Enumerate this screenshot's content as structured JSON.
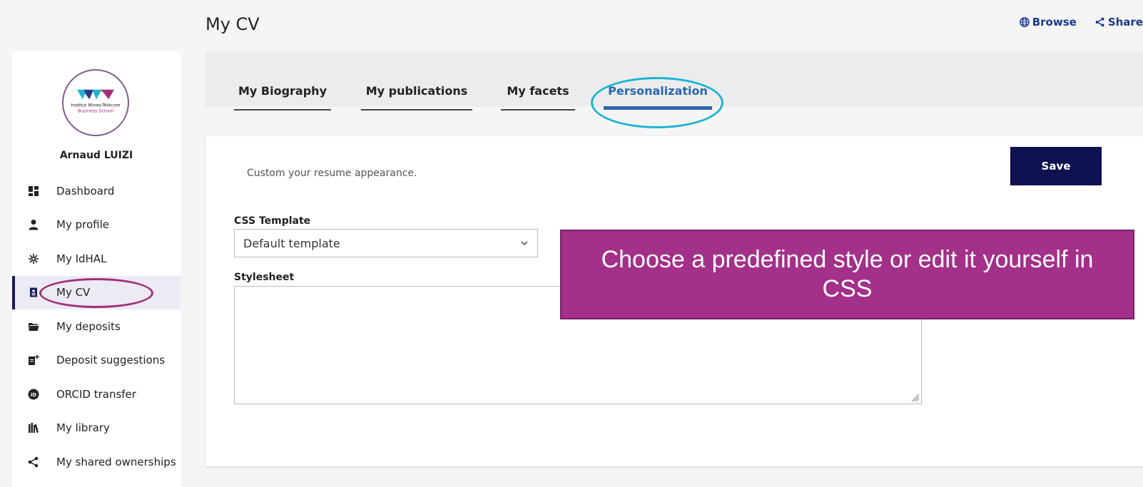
{
  "header": {
    "title": "My CV",
    "links": [
      {
        "label": "Browse",
        "icon": "globe-icon"
      },
      {
        "label": "Share",
        "icon": "share-icon"
      }
    ]
  },
  "sidebar": {
    "user_name": "Arnaud LUIZI",
    "logo_text_line1": "Institut Mines-Télécom",
    "logo_text_line2": "Business School",
    "items": [
      {
        "label": "Dashboard",
        "icon": "dashboard-icon"
      },
      {
        "label": "My profile",
        "icon": "user-icon"
      },
      {
        "label": "My IdHAL",
        "icon": "idhal-icon"
      },
      {
        "label": "My CV",
        "icon": "cv-icon",
        "active": true
      },
      {
        "label": "My deposits",
        "icon": "folder-icon"
      },
      {
        "label": "Deposit suggestions",
        "icon": "file-plus-icon"
      },
      {
        "label": "ORCID transfer",
        "icon": "orcid-icon"
      },
      {
        "label": "My library",
        "icon": "library-icon"
      },
      {
        "label": "My shared ownerships",
        "icon": "share-icon"
      }
    ]
  },
  "tabs": [
    {
      "label": "My Biography"
    },
    {
      "label": "My publications"
    },
    {
      "label": "My facets"
    },
    {
      "label": "Personalization",
      "active": true
    }
  ],
  "main": {
    "description": "Custom your resume appearance.",
    "save_label": "Save",
    "css_template_label": "CSS Template",
    "css_template_value": "Default template",
    "stylesheet_label": "Stylesheet",
    "stylesheet_value": ""
  },
  "callout": {
    "text": "Choose a predefined style or edit it yourself in CSS"
  },
  "colors": {
    "accent": "#2a68b0",
    "save_button": "#0d1150",
    "callout": "#a33089",
    "highlight_circle_tab": "#18b4d4",
    "highlight_circle_nav": "#a0307a"
  }
}
